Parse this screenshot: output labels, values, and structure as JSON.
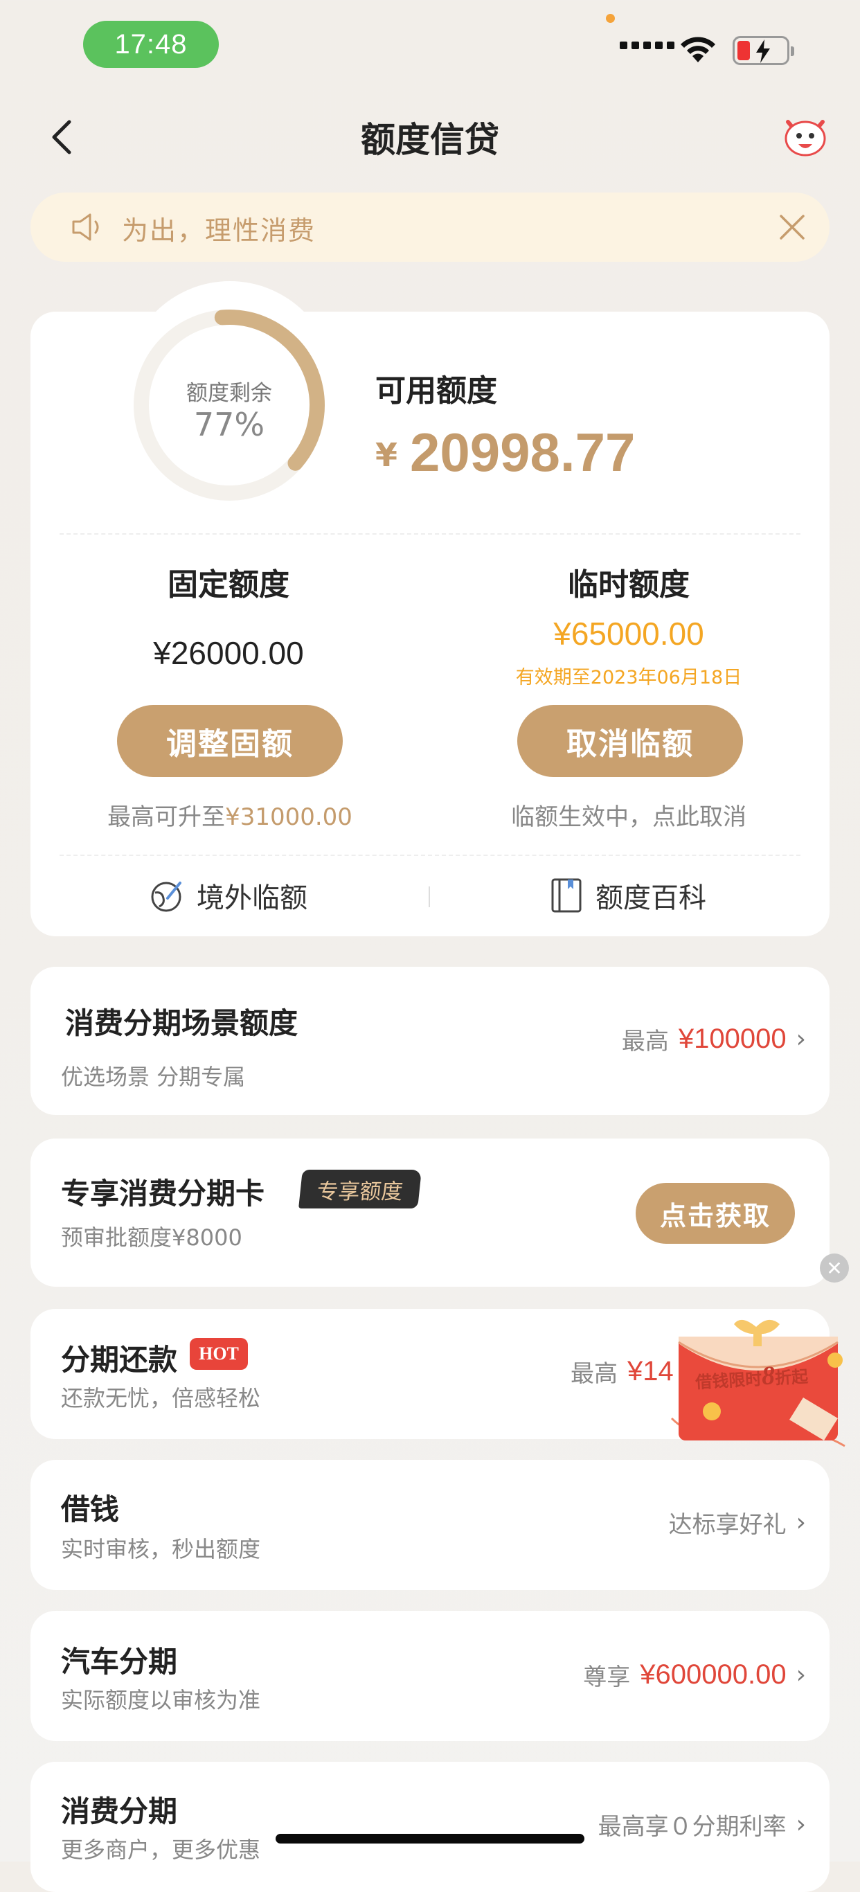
{
  "status_bar": {
    "time": "17:48"
  },
  "nav": {
    "title": "额度信贷"
  },
  "notice": {
    "text": "为出，理性消费"
  },
  "credit": {
    "gauge_label": "额度剩余",
    "gauge_percent": "77%",
    "gauge_fraction": 0.77,
    "available_label": "可用额度",
    "currency": "¥",
    "available_amount": "20998.77",
    "fixed": {
      "label": "固定额度",
      "amount": "¥26000.00",
      "button": "调整固额",
      "hint_prefix": "最高可升至",
      "hint_value": "¥31000.00"
    },
    "temporary": {
      "label": "临时额度",
      "amount": "¥65000.00",
      "expiry": "有效期至2023年06月18日",
      "button": "取消临额",
      "hint": "临额生效中，点此取消"
    },
    "links": {
      "overseas": "境外临额",
      "wiki": "额度百科"
    }
  },
  "cards": {
    "scene": {
      "title": "消费分期场景额度",
      "subtitle": "优选场景 分期专属",
      "right_label": "最高",
      "right_value": "¥100000"
    },
    "exclusive": {
      "title": "专享消费分期卡",
      "tag": "专享额度",
      "subtitle": "预审批额度¥8000",
      "button": "点击获取"
    },
    "installment_repay": {
      "title": "分期还款",
      "tag": "HOT",
      "subtitle": "还款无忧，倍感轻松",
      "right_label": "最高",
      "right_value": "¥14"
    },
    "borrow": {
      "title": "借钱",
      "subtitle": "实时审核，秒出额度",
      "right_label": "达标享好礼"
    },
    "car": {
      "title": "汽车分期",
      "subtitle": "实际额度以审核为准",
      "right_label": "尊享",
      "right_value": "¥600000.00"
    },
    "consumer": {
      "title": "消费分期",
      "subtitle": "更多商户，更多优惠",
      "right_label": "最高享０分期利率"
    }
  },
  "promo": {
    "text_prefix": "借钱限时",
    "text_num": "8",
    "text_suffix": "折起"
  },
  "colors": {
    "gold": "#c9a06f",
    "red": "#e0473a",
    "orange": "#f4a623",
    "status_green": "#5bc25d"
  }
}
